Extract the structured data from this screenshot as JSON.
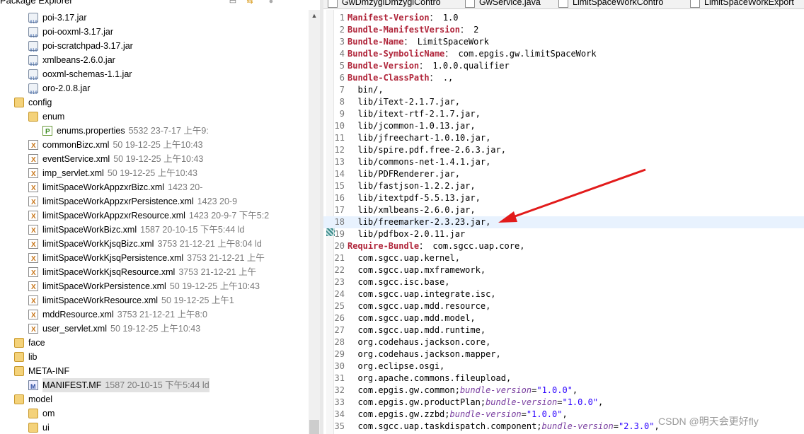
{
  "explorer": {
    "title": "Package Explorer",
    "tree": [
      {
        "label": "poi-3.17.jar",
        "meta": "",
        "icon": "jar-icon",
        "indent": 2
      },
      {
        "label": "poi-ooxml-3.17.jar",
        "meta": "",
        "icon": "jar-icon",
        "indent": 2
      },
      {
        "label": "poi-scratchpad-3.17.jar",
        "meta": "",
        "icon": "jar-icon",
        "indent": 2
      },
      {
        "label": "xmlbeans-2.6.0.jar",
        "meta": "",
        "icon": "jar-icon",
        "indent": 2
      },
      {
        "label": "ooxml-schemas-1.1.jar",
        "meta": "",
        "icon": "jar-icon",
        "indent": 2
      },
      {
        "label": "oro-2.0.8.jar",
        "meta": "",
        "icon": "jar-icon",
        "indent": 2
      },
      {
        "label": "config",
        "meta": "",
        "icon": "folder-icon",
        "indent": 1
      },
      {
        "label": "enum",
        "meta": "",
        "icon": "folder-icon",
        "indent": 2
      },
      {
        "label": "enums.properties",
        "meta": "5532  23-7-17 上午9:",
        "icon": "properties-icon",
        "indent": 3
      },
      {
        "label": "commonBizc.xml",
        "meta": "50  19-12-25 上午10:43",
        "icon": "xml-icon",
        "indent": 2
      },
      {
        "label": "eventService.xml",
        "meta": "50  19-12-25 上午10:43",
        "icon": "xml-icon",
        "indent": 2
      },
      {
        "label": "imp_servlet.xml",
        "meta": "50  19-12-25 上午10:43",
        "icon": "xml-icon",
        "indent": 2
      },
      {
        "label": "limitSpaceWorkAppzxrBizc.xml",
        "meta": "1423  20-",
        "icon": "xml-icon",
        "indent": 2
      },
      {
        "label": "limitSpaceWorkAppzxrPersistence.xml",
        "meta": "1423  20-9",
        "icon": "xml-icon",
        "indent": 2
      },
      {
        "label": "limitSpaceWorkAppzxrResource.xml",
        "meta": "1423  20-9-7  下午5:2",
        "icon": "xml-icon",
        "indent": 2
      },
      {
        "label": "limitSpaceWorkBizc.xml",
        "meta": "1587  20-10-15  下午5:44  ld",
        "icon": "xml-icon",
        "indent": 2
      },
      {
        "label": "limitSpaceWorkKjsqBizc.xml",
        "meta": "3753  21-12-21  上午8:04  ld",
        "icon": "xml-icon",
        "indent": 2
      },
      {
        "label": "limitSpaceWorkKjsqPersistence.xml",
        "meta": "3753  21-12-21  上午",
        "icon": "xml-icon",
        "indent": 2
      },
      {
        "label": "limitSpaceWorkKjsqResource.xml",
        "meta": "3753  21-12-21  上午",
        "icon": "xml-icon",
        "indent": 2
      },
      {
        "label": "limitSpaceWorkPersistence.xml",
        "meta": "50  19-12-25  上午10:43",
        "icon": "xml-icon",
        "indent": 2
      },
      {
        "label": "limitSpaceWorkResource.xml",
        "meta": "50  19-12-25  上午1",
        "icon": "xml-icon",
        "indent": 2
      },
      {
        "label": "mddResource.xml",
        "meta": "3753  21-12-21  上午8:0",
        "icon": "xml-icon",
        "indent": 2
      },
      {
        "label": "user_servlet.xml",
        "meta": "50  19-12-25  上午10:43",
        "icon": "xml-icon",
        "indent": 2
      },
      {
        "label": "face",
        "meta": "",
        "icon": "folder-icon",
        "indent": 1
      },
      {
        "label": "lib",
        "meta": "",
        "icon": "folder-icon",
        "indent": 1
      },
      {
        "label": "META-INF",
        "meta": "",
        "icon": "folder-icon",
        "indent": 1
      },
      {
        "label": "MANIFEST.MF",
        "meta": "1587  20-10-15  下午5:44  ld",
        "icon": "manifest-icon",
        "indent": 2,
        "selected": true
      },
      {
        "label": "model",
        "meta": "",
        "icon": "folder-icon",
        "indent": 1
      },
      {
        "label": "om",
        "meta": "",
        "icon": "folder-icon",
        "indent": 2
      },
      {
        "label": "ui",
        "meta": "",
        "icon": "folder-icon",
        "indent": 2
      }
    ]
  },
  "editor": {
    "tabs": [
      "GwDmzyglDmzyglContro",
      "GwService.java",
      "LimitSpaceWorkContro",
      "LimitSpaceWorkExport"
    ],
    "lines": [
      {
        "n": "1",
        "parts": [
          [
            "k",
            "Manifest-Version"
          ],
          [
            "",
            "： 1.0"
          ]
        ]
      },
      {
        "n": "2",
        "parts": [
          [
            "k",
            "Bundle-ManifestVersion"
          ],
          [
            "",
            "： 2"
          ]
        ]
      },
      {
        "n": "3",
        "parts": [
          [
            "k",
            "Bundle-Name"
          ],
          [
            "",
            "： LimitSpaceWork"
          ]
        ]
      },
      {
        "n": "4",
        "parts": [
          [
            "k",
            "Bundle-SymbolicName"
          ],
          [
            "",
            "： com.epgis.gw.limitSpaceWork"
          ]
        ]
      },
      {
        "n": "5",
        "parts": [
          [
            "k",
            "Bundle-Version"
          ],
          [
            "",
            "： 1.0.0.qualifier"
          ]
        ]
      },
      {
        "n": "6",
        "parts": [
          [
            "k",
            "Bundle-ClassPath"
          ],
          [
            "",
            "： .,"
          ]
        ]
      },
      {
        "n": "7",
        "parts": [
          [
            "",
            "  bin/,"
          ]
        ]
      },
      {
        "n": "8",
        "parts": [
          [
            "",
            "  lib/iText-2.1.7.jar,"
          ]
        ]
      },
      {
        "n": "9",
        "parts": [
          [
            "",
            "  lib/itext-rtf-2.1.7.jar,"
          ]
        ]
      },
      {
        "n": "10",
        "parts": [
          [
            "",
            "  lib/jcommon-1.0.13.jar,"
          ]
        ]
      },
      {
        "n": "11",
        "parts": [
          [
            "",
            "  lib/jfreechart-1.0.10.jar,"
          ]
        ]
      },
      {
        "n": "12",
        "parts": [
          [
            "",
            "  lib/spire.pdf.free-2.6.3.jar,"
          ]
        ]
      },
      {
        "n": "13",
        "parts": [
          [
            "",
            "  lib/commons-net-1.4.1.jar,"
          ]
        ]
      },
      {
        "n": "14",
        "parts": [
          [
            "",
            "  lib/PDFRenderer.jar,"
          ]
        ]
      },
      {
        "n": "15",
        "parts": [
          [
            "",
            "  lib/fastjson-1.2.2.jar,"
          ]
        ]
      },
      {
        "n": "16",
        "parts": [
          [
            "",
            "  lib/itextpdf-5.5.13.jar,"
          ]
        ]
      },
      {
        "n": "17",
        "parts": [
          [
            "",
            "  lib/xmlbeans-2.6.0.jar,"
          ]
        ]
      },
      {
        "n": "18",
        "parts": [
          [
            "",
            "  lib/freemarker-2.3.23.jar,"
          ]
        ],
        "highlight": true
      },
      {
        "n": "19",
        "parts": [
          [
            "",
            "  lib/pdfbox-2.0.11.jar"
          ]
        ]
      },
      {
        "n": "20",
        "parts": [
          [
            "k",
            "Require-Bundle"
          ],
          [
            "",
            "： com.sgcc.uap.core,"
          ]
        ]
      },
      {
        "n": "21",
        "parts": [
          [
            "",
            "  com.sgcc.uap.kernel,"
          ]
        ]
      },
      {
        "n": "22",
        "parts": [
          [
            "",
            "  com.sgcc.uap.mxframework,"
          ]
        ]
      },
      {
        "n": "23",
        "parts": [
          [
            "",
            "  com.sgcc.isc.base,"
          ]
        ]
      },
      {
        "n": "24",
        "parts": [
          [
            "",
            "  com.sgcc.uap.integrate.isc,"
          ]
        ]
      },
      {
        "n": "25",
        "parts": [
          [
            "",
            "  com.sgcc.uap.mdd.resource,"
          ]
        ]
      },
      {
        "n": "26",
        "parts": [
          [
            "",
            "  com.sgcc.uap.mdd.model,"
          ]
        ]
      },
      {
        "n": "27",
        "parts": [
          [
            "",
            "  com.sgcc.uap.mdd.runtime,"
          ]
        ]
      },
      {
        "n": "28",
        "parts": [
          [
            "",
            "  org.codehaus.jackson.core,"
          ]
        ]
      },
      {
        "n": "29",
        "parts": [
          [
            "",
            "  org.codehaus.jackson.mapper,"
          ]
        ]
      },
      {
        "n": "30",
        "parts": [
          [
            "",
            "  org.eclipse.osgi,"
          ]
        ]
      },
      {
        "n": "31",
        "parts": [
          [
            "",
            "  org.apache.commons.fileupload,"
          ]
        ]
      },
      {
        "n": "32",
        "parts": [
          [
            "",
            "  com.epgis.gw.common;"
          ],
          [
            "it",
            "bundle-version"
          ],
          [
            "",
            "="
          ],
          [
            "s",
            "\"1.0.0\""
          ],
          [
            "",
            ","
          ]
        ]
      },
      {
        "n": "33",
        "parts": [
          [
            "",
            "  com.epgis.gw.productPlan;"
          ],
          [
            "it",
            "bundle-version"
          ],
          [
            "",
            "="
          ],
          [
            "s",
            "\"1.0.0\""
          ],
          [
            "",
            ","
          ]
        ]
      },
      {
        "n": "34",
        "parts": [
          [
            "",
            "  com.epgis.gw.zzbd;"
          ],
          [
            "it",
            "bundle-version"
          ],
          [
            "",
            "="
          ],
          [
            "s",
            "\"1.0.0\""
          ],
          [
            "",
            ","
          ]
        ]
      },
      {
        "n": "35",
        "parts": [
          [
            "",
            "  com.sgcc.uap.taskdispatch.component;"
          ],
          [
            "it",
            "bundle-version"
          ],
          [
            "",
            "="
          ],
          [
            "s",
            "\"2.3.0\""
          ],
          [
            "",
            ","
          ]
        ]
      }
    ]
  },
  "watermark": "CSDN @明天会更好fly",
  "colors": {
    "keyword": "#b0253a",
    "attribute": "#7a3fa0",
    "string": "#2a00ff",
    "arrow": "#e21b1b",
    "highlight": "#e8f2fe"
  }
}
